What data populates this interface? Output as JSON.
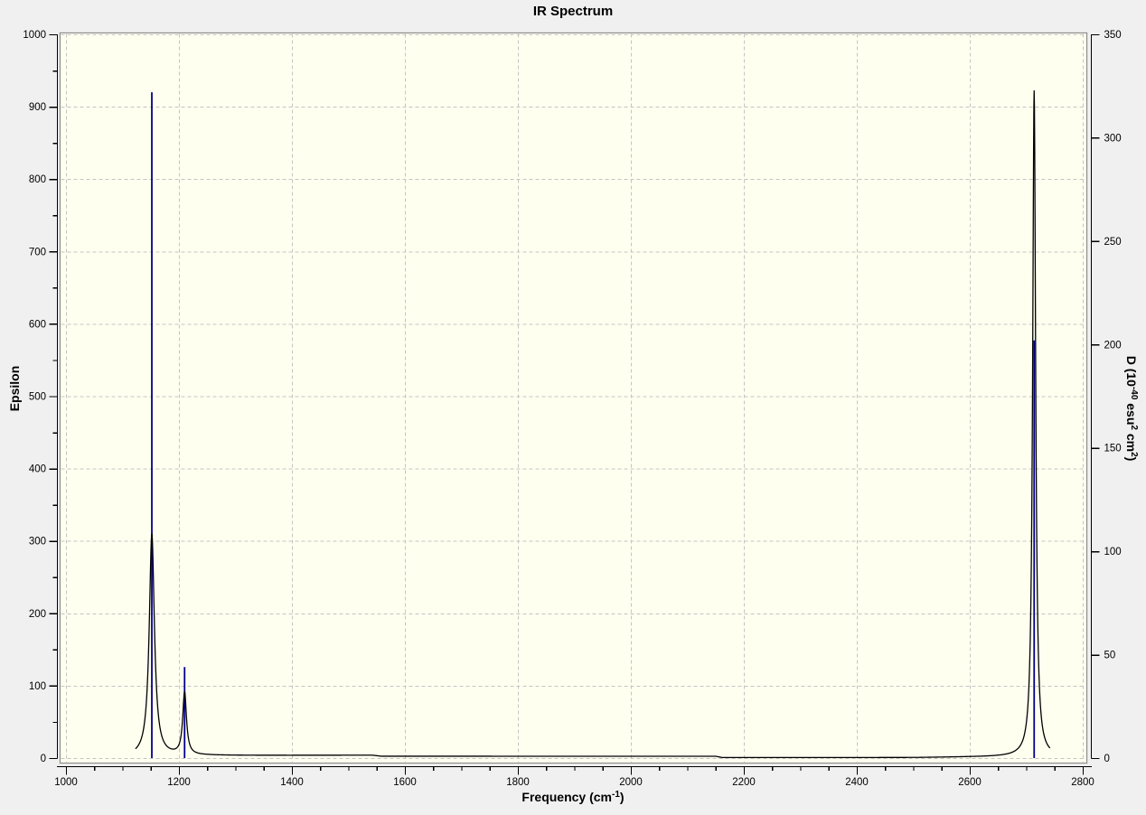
{
  "title": "IR Spectrum",
  "axes": {
    "x": {
      "label_parts": [
        "Frequency (cm",
        "-1",
        ")"
      ],
      "range": [
        1000,
        2800
      ],
      "tick_labels": [
        1000,
        1200,
        1400,
        1600,
        1800,
        2000,
        2200,
        2400,
        2600,
        2800
      ],
      "minor_step": 50
    },
    "y_left": {
      "label": "Epsilon",
      "range": [
        0,
        1000
      ],
      "tick_labels": [
        0,
        100,
        200,
        300,
        400,
        500,
        600,
        700,
        800,
        900,
        1000
      ],
      "minor_step": 50
    },
    "y_right": {
      "label_parts": [
        "D (10",
        "-40",
        " esu",
        "2",
        " cm",
        "2",
        ")"
      ],
      "range": [
        0,
        350
      ],
      "tick_labels": [
        0,
        50,
        100,
        150,
        200,
        250,
        300,
        350
      ]
    }
  },
  "colors": {
    "background": "#f0f0f0",
    "plot_background": "#fffff0",
    "grid": "#c4c4c4",
    "frame": "#8a8a8a",
    "frame_highlight": "#e2e2e2",
    "axis": "#000000",
    "curve": "#000000",
    "stick": "#00008b",
    "text": "#000000"
  },
  "chart_data": {
    "type": "line",
    "title": "IR Spectrum",
    "xlabel": "Frequency (cm^-1)",
    "ylabel_left": "Epsilon",
    "ylabel_right": "D (10^-40 esu^2 cm^2)",
    "x_range": [
      1000,
      2800
    ],
    "y_left_range": [
      0,
      1000
    ],
    "y_right_range": [
      0,
      350
    ],
    "grid": true,
    "legend": false,
    "series": [
      {
        "name": "dipole-strength-sticks",
        "axis": "right",
        "type": "stick",
        "points": [
          {
            "freq": 1152,
            "D": 322
          },
          {
            "freq": 1210,
            "D": 44
          },
          {
            "freq": 2714,
            "D": 202
          }
        ]
      },
      {
        "name": "epsilon-curve",
        "axis": "left",
        "type": "lorentzian_sum",
        "domain": [
          1123,
          2742
        ],
        "peaks": [
          {
            "freq": 1152,
            "eps_max": 307,
            "hwhm": 5.5
          },
          {
            "freq": 1210,
            "eps_max": 86,
            "hwhm": 4
          },
          {
            "freq": 2714,
            "eps_max": 920,
            "hwhm": 3.2
          }
        ],
        "baseline_points": [
          [
            1123,
            2
          ],
          [
            1250,
            3.5
          ],
          [
            1542,
            4
          ],
          [
            1558,
            2.5
          ],
          [
            2150,
            2.5
          ],
          [
            2162,
            0.7
          ],
          [
            2505,
            0.7
          ],
          [
            2600,
            1.5
          ],
          [
            2690,
            2
          ]
        ]
      }
    ]
  }
}
